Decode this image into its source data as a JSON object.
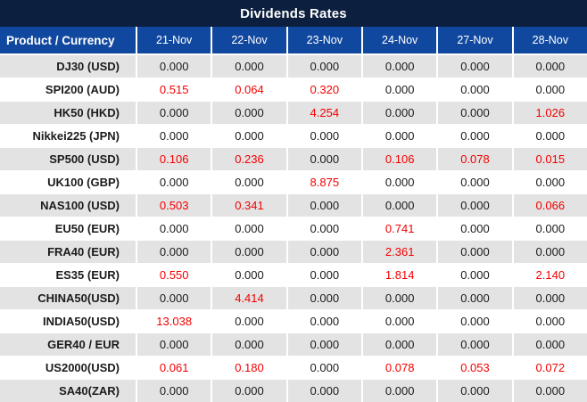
{
  "title": "Dividends Rates",
  "colors": {
    "title_bg": "#0C1F3E",
    "header_bg": "#11489F",
    "header_text": "#FFFFFF",
    "row_alt_bg": "#E3E3E3",
    "row_plain_bg": "#FFFFFF",
    "gridline": "#FFFFFF",
    "value_zero_text": "#1B1B1B",
    "value_nonzero_text": "#F40000"
  },
  "table": {
    "product_header": "Product / Currency",
    "date_headers": [
      "21-Nov",
      "22-Nov",
      "23-Nov",
      "24-Nov",
      "27-Nov",
      "28-Nov"
    ],
    "zero_display": "0.000",
    "rows": [
      {
        "product": "DJ30 (USD)",
        "values": [
          "0.000",
          "0.000",
          "0.000",
          "0.000",
          "0.000",
          "0.000"
        ]
      },
      {
        "product": "SPI200 (AUD)",
        "values": [
          "0.515",
          "0.064",
          "0.320",
          "0.000",
          "0.000",
          "0.000"
        ]
      },
      {
        "product": "HK50 (HKD)",
        "values": [
          "0.000",
          "0.000",
          "4.254",
          "0.000",
          "0.000",
          "1.026"
        ]
      },
      {
        "product": "Nikkei225 (JPN)",
        "values": [
          "0.000",
          "0.000",
          "0.000",
          "0.000",
          "0.000",
          "0.000"
        ]
      },
      {
        "product": "SP500 (USD)",
        "values": [
          "0.106",
          "0.236",
          "0.000",
          "0.106",
          "0.078",
          "0.015"
        ]
      },
      {
        "product": "UK100 (GBP)",
        "values": [
          "0.000",
          "0.000",
          "8.875",
          "0.000",
          "0.000",
          "0.000"
        ]
      },
      {
        "product": "NAS100 (USD)",
        "values": [
          "0.503",
          "0.341",
          "0.000",
          "0.000",
          "0.000",
          "0.066"
        ]
      },
      {
        "product": "EU50 (EUR)",
        "values": [
          "0.000",
          "0.000",
          "0.000",
          "0.741",
          "0.000",
          "0.000"
        ]
      },
      {
        "product": "FRA40 (EUR)",
        "values": [
          "0.000",
          "0.000",
          "0.000",
          "2.361",
          "0.000",
          "0.000"
        ]
      },
      {
        "product": "ES35 (EUR)",
        "values": [
          "0.550",
          "0.000",
          "0.000",
          "1.814",
          "0.000",
          "2.140"
        ]
      },
      {
        "product": "CHINA50(USD)",
        "values": [
          "0.000",
          "4.414",
          "0.000",
          "0.000",
          "0.000",
          "0.000"
        ]
      },
      {
        "product": "INDIA50(USD)",
        "values": [
          "13.038",
          "0.000",
          "0.000",
          "0.000",
          "0.000",
          "0.000"
        ]
      },
      {
        "product": "GER40 / EUR",
        "values": [
          "0.000",
          "0.000",
          "0.000",
          "0.000",
          "0.000",
          "0.000"
        ]
      },
      {
        "product": "US2000(USD)",
        "values": [
          "0.061",
          "0.180",
          "0.000",
          "0.078",
          "0.053",
          "0.072"
        ]
      },
      {
        "product": "SA40(ZAR)",
        "values": [
          "0.000",
          "0.000",
          "0.000",
          "0.000",
          "0.000",
          "0.000"
        ]
      }
    ]
  },
  "chart_data": {
    "type": "table",
    "title": "Dividends Rates",
    "columns": [
      "Product / Currency",
      "21-Nov",
      "22-Nov",
      "23-Nov",
      "24-Nov",
      "27-Nov",
      "28-Nov"
    ],
    "rows": [
      [
        "DJ30 (USD)",
        0.0,
        0.0,
        0.0,
        0.0,
        0.0,
        0.0
      ],
      [
        "SPI200 (AUD)",
        0.515,
        0.064,
        0.32,
        0.0,
        0.0,
        0.0
      ],
      [
        "HK50 (HKD)",
        0.0,
        0.0,
        4.254,
        0.0,
        0.0,
        1.026
      ],
      [
        "Nikkei225 (JPN)",
        0.0,
        0.0,
        0.0,
        0.0,
        0.0,
        0.0
      ],
      [
        "SP500 (USD)",
        0.106,
        0.236,
        0.0,
        0.106,
        0.078,
        0.015
      ],
      [
        "UK100 (GBP)",
        0.0,
        0.0,
        8.875,
        0.0,
        0.0,
        0.0
      ],
      [
        "NAS100 (USD)",
        0.503,
        0.341,
        0.0,
        0.0,
        0.0,
        0.066
      ],
      [
        "EU50 (EUR)",
        0.0,
        0.0,
        0.0,
        0.741,
        0.0,
        0.0
      ],
      [
        "FRA40 (EUR)",
        0.0,
        0.0,
        0.0,
        2.361,
        0.0,
        0.0
      ],
      [
        "ES35 (EUR)",
        0.55,
        0.0,
        0.0,
        1.814,
        0.0,
        2.14
      ],
      [
        "CHINA50(USD)",
        0.0,
        4.414,
        0.0,
        0.0,
        0.0,
        0.0
      ],
      [
        "INDIA50(USD)",
        13.038,
        0.0,
        0.0,
        0.0,
        0.0,
        0.0
      ],
      [
        "GER40 / EUR",
        0.0,
        0.0,
        0.0,
        0.0,
        0.0,
        0.0
      ],
      [
        "US2000(USD)",
        0.061,
        0.18,
        0.0,
        0.078,
        0.053,
        0.072
      ],
      [
        "SA40(ZAR)",
        0.0,
        0.0,
        0.0,
        0.0,
        0.0,
        0.0
      ]
    ],
    "legend": null,
    "notes": "Zero values rendered in near-black; non-zero values rendered in red."
  }
}
